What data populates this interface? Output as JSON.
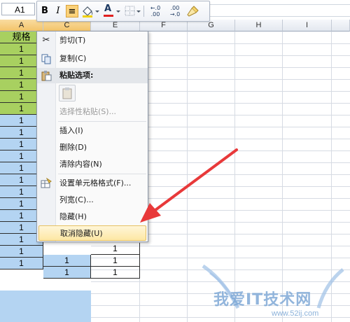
{
  "name_box": "A1",
  "toolbar": {
    "bold": "B",
    "italic": "I",
    "align": "≡",
    "fill_color": "A",
    "decrease_decimal": "←.0\n.00",
    "increase_decimal": ".00\n→.0"
  },
  "columns": [
    "A",
    "C",
    "E",
    "F",
    "G",
    "H",
    "I"
  ],
  "header_cell": "规格",
  "col_a_values": [
    "1",
    "1",
    "1",
    "1",
    "1",
    "1",
    "1",
    "1",
    "1",
    "1",
    "1",
    "1",
    "1",
    "1",
    "1",
    "1",
    "1",
    "1",
    "1"
  ],
  "col_c_values": [
    "1",
    "1"
  ],
  "col_e_values": [
    "1",
    "1",
    "1"
  ],
  "context_menu": {
    "cut": "剪切(T)",
    "copy": "复制(C)",
    "paste_options": "粘贴选项:",
    "paste_special": "选择性粘贴(S)...",
    "insert": "插入(I)",
    "delete": "删除(D)",
    "clear": "清除内容(N)",
    "format_cells": "设置单元格格式(F)...",
    "column_width": "列宽(C)...",
    "hide": "隐藏(H)",
    "unhide": "取消隐藏(U)"
  },
  "colors": {
    "green": "#a8d060",
    "blue": "#b4d4f2",
    "highlight": "#fde7a4",
    "arrow": "#e8393a"
  },
  "icons": [
    "scissors-icon",
    "copy-icon",
    "paste-icon",
    "format-cells-icon",
    "bold-icon",
    "italic-icon",
    "align-center-icon",
    "fill-color-icon",
    "font-color-icon",
    "borders-icon",
    "format-painter-icon"
  ],
  "watermark": {
    "text": "我爱IT技术网",
    "url": "www.52ij.com"
  }
}
